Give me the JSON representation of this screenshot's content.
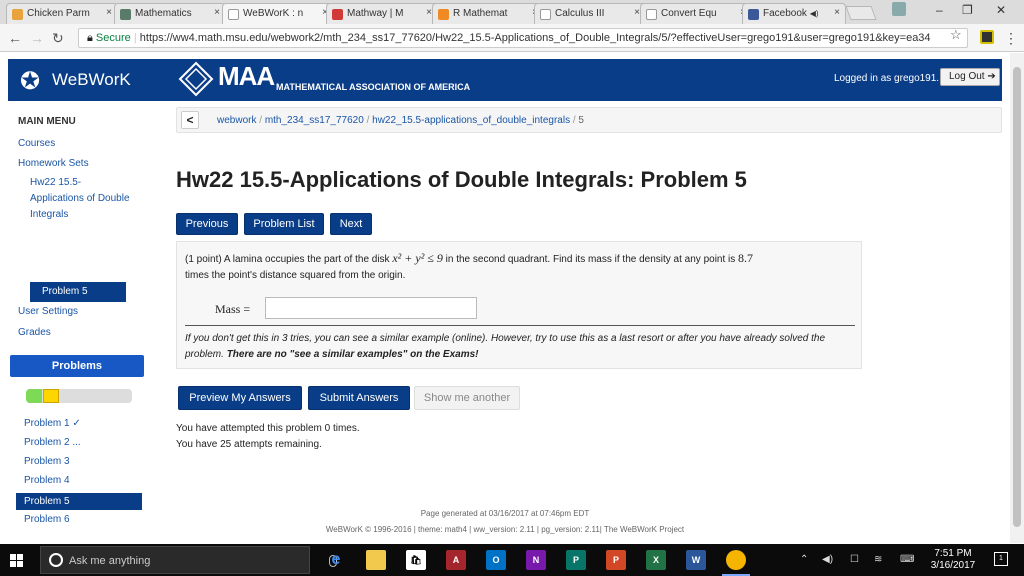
{
  "browser": {
    "tabs": [
      {
        "label": "Chicken Parm",
        "favicon_color": "#e8a33d"
      },
      {
        "label": "Mathematics",
        "favicon_color": "#5a7a6a"
      },
      {
        "label": "WeBWorK : n",
        "favicon_color": "#ffffff"
      },
      {
        "label": "Mathway | M",
        "favicon_color": "#d23a3a"
      },
      {
        "label": "R Mathemat",
        "favicon_color": "#f08a24"
      },
      {
        "label": "Calculus III",
        "favicon_color": "#ffffff"
      },
      {
        "label": "Convert Equ",
        "favicon_color": "#ffffff"
      },
      {
        "label": "Facebook",
        "favicon_color": "#3b5998"
      }
    ],
    "active_tab": 2,
    "tab_close": "×",
    "facebook_audio": "◀)",
    "secure_label": "Secure",
    "url": "https://ww4.math.msu.edu/webwork2/mth_234_ss17_77620/Hw22_15.5-Applications_of_Double_Integrals/5/?effectiveUser=grego191&user=grego191&key=ea34"
  },
  "header": {
    "logo_text": "WeBWorK",
    "maa_text": "MAA",
    "maa_sub": "MATHEMATICAL ASSOCIATION OF AMERICA",
    "login_text": "Logged in as grego191.",
    "logout_label": "Log Out ➔"
  },
  "sidebar": {
    "menu_title": "MAIN MENU",
    "courses": "Courses",
    "homework_sets": "Homework Sets",
    "current_set": "Hw22 15.5-Applications of Double Integrals",
    "current_problem": "Problem 5",
    "user_settings": "User Settings",
    "grades": "Grades",
    "problems_title": "Problems",
    "problem_links": [
      "Problem 1 ✓",
      "Problem 2 ...",
      "Problem 3",
      "Problem 4",
      "Problem 5",
      "Problem 6"
    ]
  },
  "breadcrumb": {
    "back": "<",
    "webwork": "webwork",
    "course": "mth_234_ss17_77620",
    "set": "hw22_15.5-applications_of_double_integrals",
    "problem": "5"
  },
  "main": {
    "title": "Hw22 15.5-Applications of Double Integrals: Problem 5",
    "nav_previous": "Previous",
    "nav_problem_list": "Problem List",
    "nav_next": "Next",
    "problem_text_1": "(1 point) A lamina occupies the part of the disk",
    "problem_math_1": "x² + y² ≤ 9",
    "problem_text_2": "in the second quadrant. Find its mass if the density at any point is",
    "problem_math_2": "8.7",
    "problem_text_3": "times the point's distance squared from the origin.",
    "mass_label": "Mass =",
    "mass_value": "",
    "note_text": "If you don't get this in 3 tries, you can see a similar example (online). However, try to use this as a last resort or after you have already solved the problem.",
    "note_bold": "There are no \"see a similar examples\" on the Exams!",
    "preview_button": "Preview My Answers",
    "submit_button": "Submit Answers",
    "show_another_button": "Show me another",
    "attempts_text": "You have attempted this problem 0 times.",
    "remaining_text": "You have 25 attempts remaining."
  },
  "footer": {
    "generated": "Page generated at 03/16/2017 at 07:46pm EDT",
    "version": "WeBWorK © 1996-2016 | theme: math4 | ww_version: 2.11 | pg_version: 2.11| The WeBWorK Project"
  },
  "taskbar": {
    "search_placeholder": "Ask me anything",
    "time": "7:51 PM",
    "date": "3/16/2017",
    "notification_count": "1"
  }
}
